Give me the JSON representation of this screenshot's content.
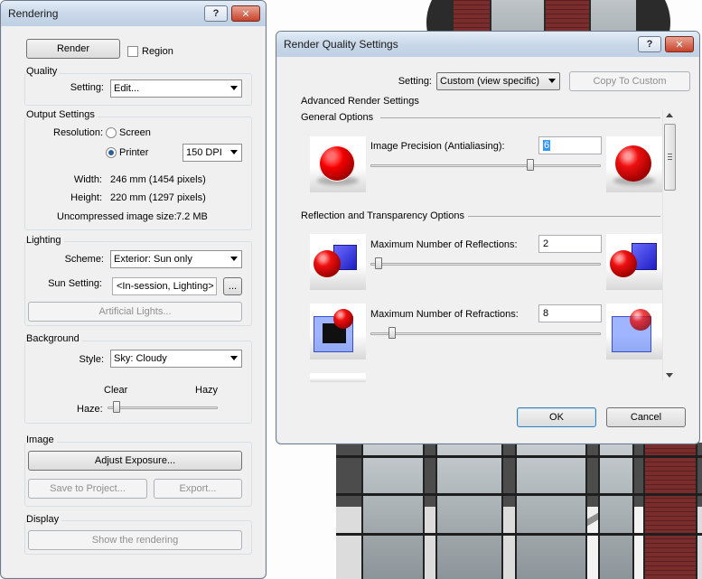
{
  "rendering": {
    "title": "Rendering",
    "titlebar_help": "?",
    "titlebar_close": "✕",
    "render_button": "Render",
    "region_label": "Region",
    "quality": {
      "group": "Quality",
      "setting_label": "Setting:",
      "setting_value": "Edit..."
    },
    "output": {
      "group": "Output Settings",
      "resolution_label": "Resolution:",
      "screen_label": "Screen",
      "printer_label": "Printer",
      "dpi_value": "150 DPI",
      "width_label": "Width:",
      "width_value": "246 mm (1454 pixels)",
      "height_label": "Height:",
      "height_value": "220 mm (1297 pixels)",
      "size_label": "Uncompressed image size:",
      "size_value": "7.2 MB"
    },
    "lighting": {
      "group": "Lighting",
      "scheme_label": "Scheme:",
      "scheme_value": "Exterior: Sun only",
      "sun_label": "Sun Setting:",
      "sun_value": "<In-session, Lighting>",
      "sun_browse": "...",
      "artificial_button": "Artificial Lights..."
    },
    "background": {
      "group": "Background",
      "style_label": "Style:",
      "style_value": "Sky: Cloudy",
      "clear_label": "Clear",
      "hazy_label": "Hazy",
      "haze_label": "Haze:",
      "haze_level": 0.05
    },
    "image": {
      "group": "Image",
      "adjust_button": "Adjust Exposure...",
      "save_button": "Save to Project...",
      "export_button": "Export..."
    },
    "display": {
      "group": "Display",
      "show_button": "Show the rendering"
    }
  },
  "quality_dialog": {
    "title": "Render Quality Settings",
    "titlebar_help": "?",
    "titlebar_close": "✕",
    "setting_label": "Setting:",
    "setting_value": "Custom (view specific)",
    "copy_button": "Copy To Custom",
    "advanced_label": "Advanced Render Settings",
    "general_label": "General Options",
    "precision_label": "Image Precision (Antialiasing):",
    "precision_value": "6",
    "precision_level": 0.7,
    "reflection_section": "Reflection and Transparency Options",
    "reflections_label": "Maximum Number of Reflections:",
    "reflections_value": "2",
    "reflections_level": 0.02,
    "refractions_label": "Maximum Number of Refractions:",
    "refractions_value": "8",
    "refractions_level": 0.08,
    "ok_button": "OK",
    "cancel_button": "Cancel"
  }
}
